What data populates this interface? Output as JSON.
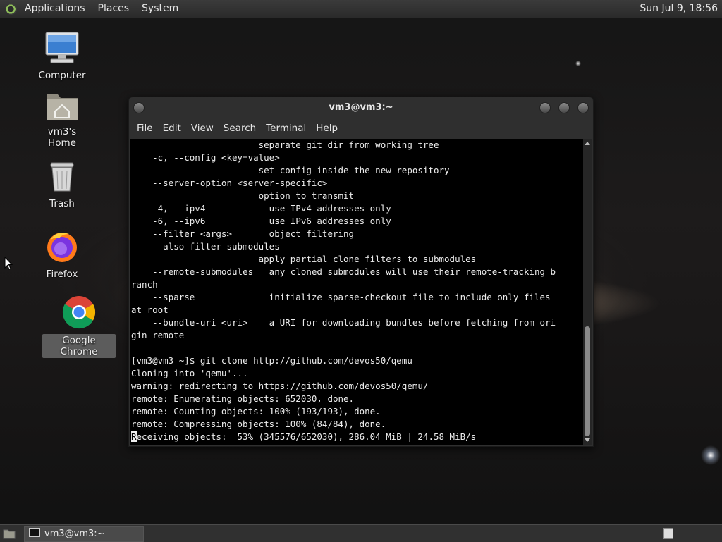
{
  "topbar": {
    "menus": [
      "Applications",
      "Places",
      "System"
    ],
    "clock": "Sun Jul  9, 18:56"
  },
  "desktop_icons": [
    {
      "label": "Computer",
      "icon": "computer-icon"
    },
    {
      "label": "vm3's Home",
      "icon": "home-folder-icon"
    },
    {
      "label": "Trash",
      "icon": "trash-icon"
    },
    {
      "label": "Firefox",
      "icon": "firefox-icon"
    },
    {
      "label": "Google Chrome",
      "icon": "chrome-icon"
    }
  ],
  "window": {
    "title": "vm3@vm3:~",
    "menus": [
      "File",
      "Edit",
      "View",
      "Search",
      "Terminal",
      "Help"
    ]
  },
  "terminal": {
    "lines": [
      "                        separate git dir from working tree",
      "    -c, --config <key=value>",
      "                        set config inside the new repository",
      "    --server-option <server-specific>",
      "                        option to transmit",
      "    -4, --ipv4            use IPv4 addresses only",
      "    -6, --ipv6            use IPv6 addresses only",
      "    --filter <args>       object filtering",
      "    --also-filter-submodules",
      "                        apply partial clone filters to submodules",
      "    --remote-submodules   any cloned submodules will use their remote-tracking b",
      "ranch",
      "    --sparse              initialize sparse-checkout file to include only files",
      "at root",
      "    --bundle-uri <uri>    a URI for downloading bundles before fetching from ori",
      "gin remote",
      "",
      "[vm3@vm3 ~]$ git clone http://github.com/devos50/qemu",
      "Cloning into 'qemu'...",
      "warning: redirecting to https://github.com/devos50/qemu/",
      "remote: Enumerating objects: 652030, done.",
      "remote: Counting objects: 100% (193/193), done.",
      "remote: Compressing objects: 100% (84/84), done."
    ],
    "cursor_char": "R",
    "last_line_rest": "eceiving objects:  53% (345576/652030), 286.04 MiB | 24.58 MiB/s"
  },
  "taskbar": {
    "task_label": "vm3@vm3:~"
  }
}
